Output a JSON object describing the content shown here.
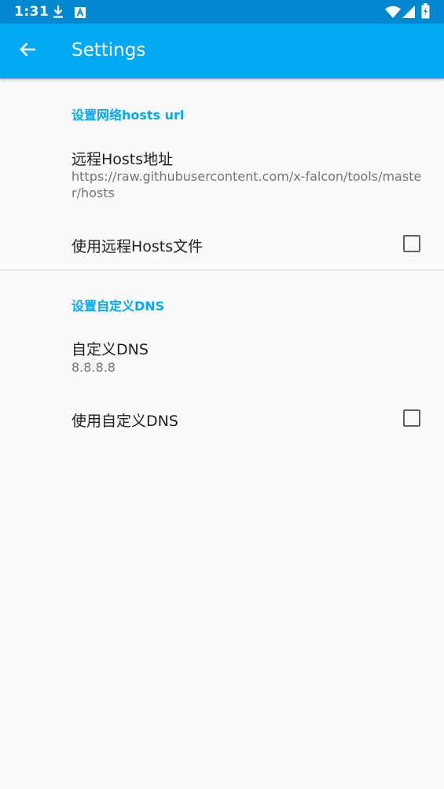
{
  "status_bar": {
    "time": "1:31",
    "icons": [
      "download-icon",
      "a-icon",
      "wifi-icon",
      "signal-icon",
      "battery-icon"
    ]
  },
  "app_bar": {
    "back_icon": "arrow-back-icon",
    "title": "Settings",
    "color": "#03a9f4"
  },
  "categories": [
    {
      "title": "设置网络hosts url",
      "remote_hosts": {
        "title": "远程Hosts地址",
        "summary": "https://raw.githubusercontent.com/x-falcon/tools/master/hosts"
      },
      "use_remote_hosts": {
        "title": "使用远程Hosts文件",
        "checked": false
      }
    },
    {
      "title": "设置自定义DNS",
      "custom_dns": {
        "title": "自定义DNS",
        "summary": "8.8.8.8"
      },
      "use_custom_dns": {
        "title": "使用自定义DNS",
        "checked": false
      }
    }
  ],
  "colors": {
    "accent": "#03a9f4",
    "status_bar": "#0288d1",
    "background": "#fafafa"
  }
}
